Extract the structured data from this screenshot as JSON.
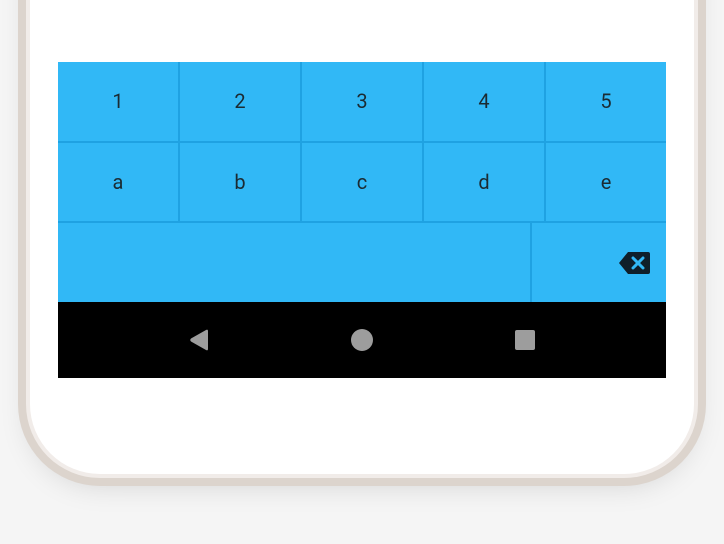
{
  "keyboard": {
    "background_color": "#31b8f6",
    "border_color": "#1fa2e2",
    "key_text_color": "#1b2b33",
    "rows": [
      {
        "keys": [
          "1",
          "2",
          "3",
          "4",
          "5"
        ]
      },
      {
        "keys": [
          "a",
          "b",
          "c",
          "d",
          "e"
        ]
      }
    ],
    "action_row": {
      "space": true,
      "backspace_icon": "backspace-icon"
    }
  },
  "nav_bar": {
    "background_color": "#000000",
    "icon_color": "#9d9d9d",
    "buttons": {
      "back": "triangle-left-icon",
      "home": "circle-icon",
      "recents": "square-icon"
    }
  }
}
